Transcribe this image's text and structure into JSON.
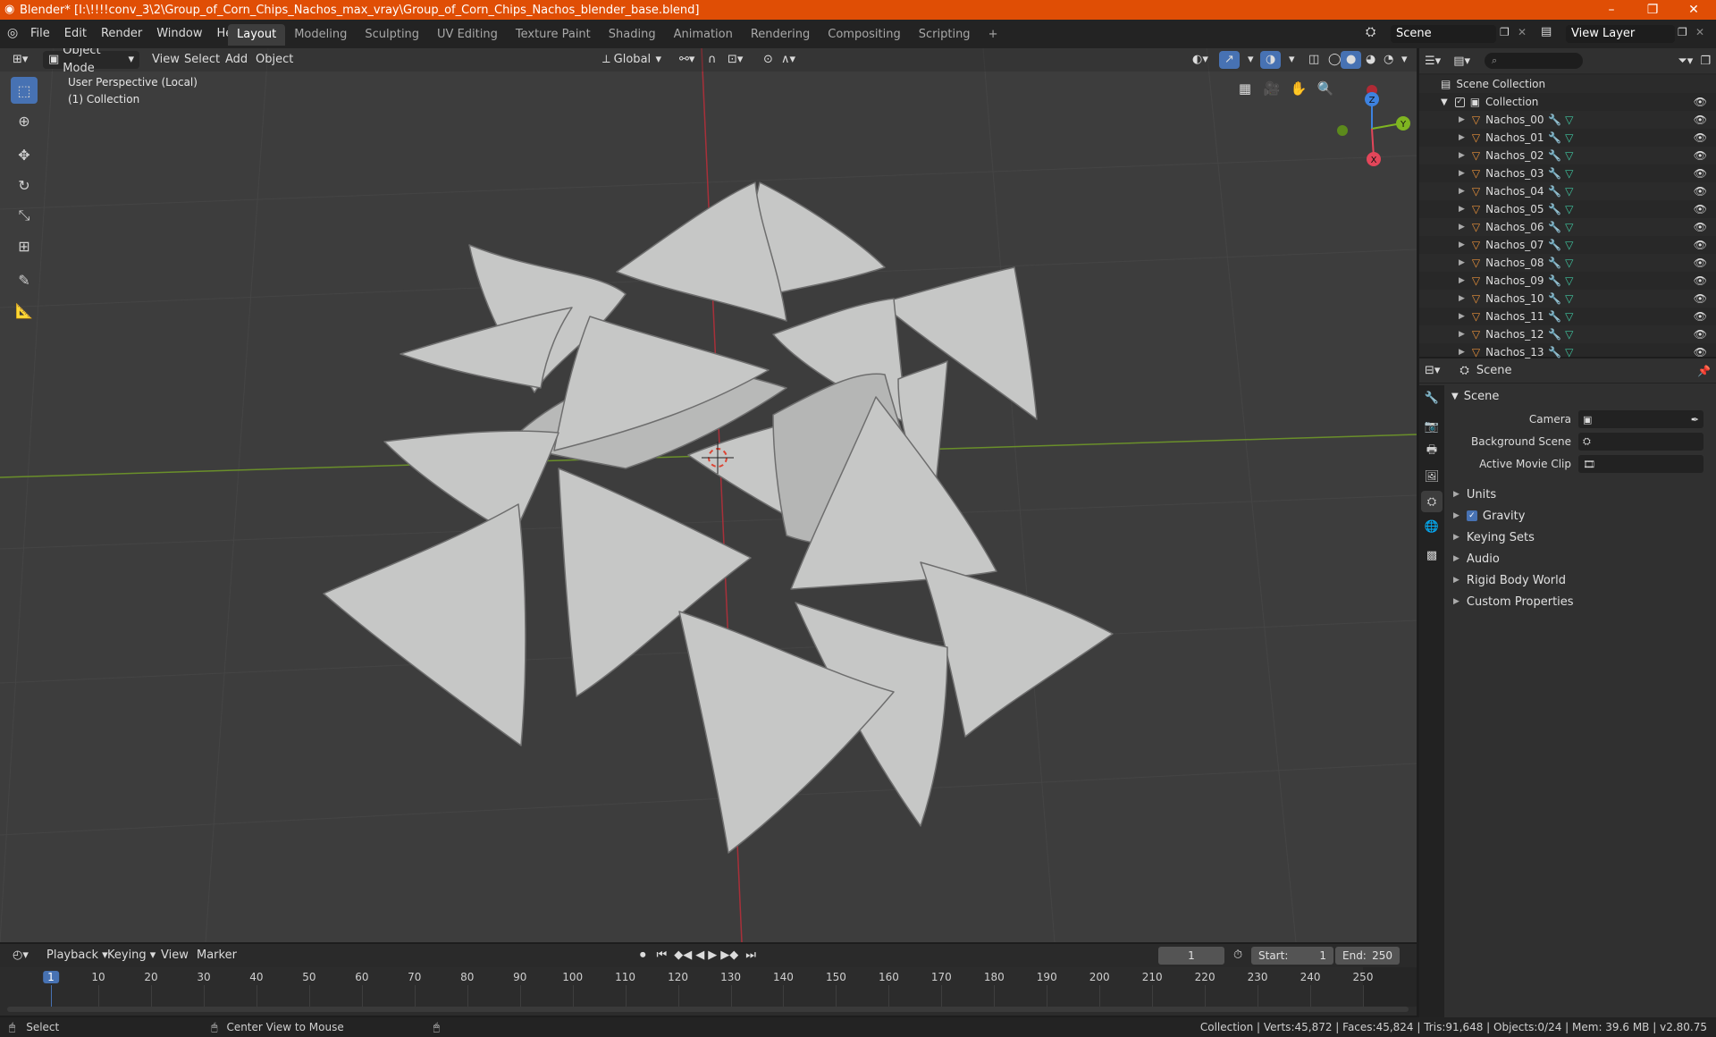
{
  "window": {
    "title": "Blender* [I:\\!!!!conv_3\\2\\Group_of_Corn_Chips_Nachos_max_vray\\Group_of_Corn_Chips_Nachos_blender_base.blend]",
    "minimize": "–",
    "restore": "❐",
    "close": "✕"
  },
  "menus": [
    "File",
    "Edit",
    "Render",
    "Window",
    "Help"
  ],
  "workspace_tabs": [
    "Layout",
    "Modeling",
    "Sculpting",
    "UV Editing",
    "Texture Paint",
    "Shading",
    "Animation",
    "Rendering",
    "Compositing",
    "Scripting"
  ],
  "workspace_add": "+",
  "scene_selector": {
    "value": "Scene"
  },
  "view_layer_selector": {
    "value": "View Layer"
  },
  "viewport": {
    "mode": "Object Mode",
    "menus": [
      "View",
      "Select",
      "Add",
      "Object"
    ],
    "transform_orientation": "Global",
    "overlay_line1": "User Perspective (Local)",
    "overlay_line2": "(1) Collection",
    "gizmo": {
      "x": "X",
      "y": "Y",
      "z": "Z"
    }
  },
  "outliner": {
    "root": "Scene Collection",
    "collection": "Collection",
    "objects": [
      "Nachos_00",
      "Nachos_01",
      "Nachos_02",
      "Nachos_03",
      "Nachos_04",
      "Nachos_05",
      "Nachos_06",
      "Nachos_07",
      "Nachos_08",
      "Nachos_09",
      "Nachos_10",
      "Nachos_11",
      "Nachos_12",
      "Nachos_13"
    ]
  },
  "properties": {
    "context": "Scene",
    "panel_title": "Scene",
    "fields": [
      {
        "label": "Camera"
      },
      {
        "label": "Background Scene"
      },
      {
        "label": "Active Movie Clip"
      }
    ],
    "subpanels": [
      "Units",
      "Gravity",
      "Keying Sets",
      "Audio",
      "Rigid Body World",
      "Custom Properties"
    ],
    "gravity_checked": true
  },
  "timeline": {
    "menus": [
      "Playback",
      "Keying",
      "View",
      "Marker"
    ],
    "current_frame": "1",
    "start_label": "Start:",
    "start_value": "1",
    "end_label": "End:",
    "end_value": "250",
    "ticks": [
      "1",
      "10",
      "20",
      "30",
      "40",
      "50",
      "60",
      "70",
      "80",
      "90",
      "100",
      "110",
      "120",
      "130",
      "140",
      "150",
      "160",
      "170",
      "180",
      "190",
      "200",
      "210",
      "220",
      "230",
      "240",
      "250"
    ]
  },
  "statusbar": {
    "left": "Select",
    "middle": "Center View to Mouse",
    "right": "Collection | Verts:45,872 | Faces:45,824 | Tris:91,648 | Objects:0/24 | Mem: 39.6 MB | v2.80.75"
  },
  "colors": {
    "titlebar": "#e04e05",
    "accent": "#4772b3",
    "viewport_bg": "#3d3d3d",
    "x_axis": "#e3465a",
    "y_axis": "#7fb521",
    "z_axis": "#3d82e0",
    "object_icon": "#e8913a",
    "mesh_icon": "#3fc6a0"
  }
}
